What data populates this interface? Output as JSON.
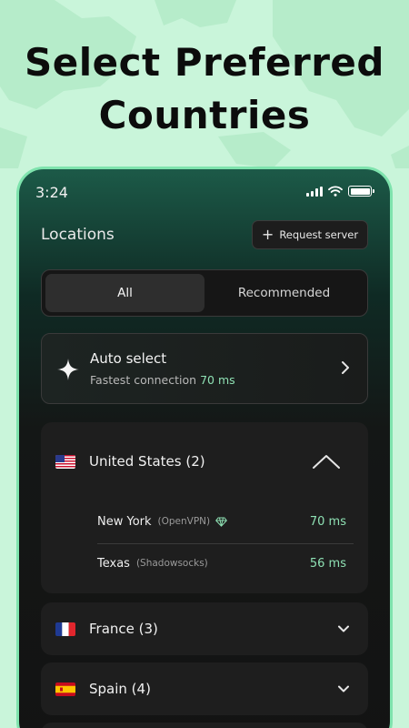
{
  "headline": {
    "line1": "Select Preferred",
    "line2": "Countries"
  },
  "status_bar": {
    "time": "3:24"
  },
  "header": {
    "title": "Locations",
    "request_label": "Request server"
  },
  "tabs": [
    {
      "label": "All",
      "active": true
    },
    {
      "label": "Recommended",
      "active": false
    }
  ],
  "auto_select": {
    "title": "Auto select",
    "subtitle": "Fastest connection",
    "ping": "70 ms"
  },
  "countries": [
    {
      "name": "United States (2)",
      "flag": "us-flag-icon",
      "expanded": true,
      "servers": [
        {
          "city": "New York",
          "protocol": "(OpenVPN)",
          "premium": true,
          "ping": "70 ms"
        },
        {
          "city": "Texas",
          "protocol": "(Shadowsocks)",
          "premium": false,
          "ping": "56 ms"
        }
      ]
    },
    {
      "name": "France (3)",
      "flag": "france-flag-icon",
      "expanded": false
    },
    {
      "name": "Spain (4)",
      "flag": "spain-flag-icon",
      "expanded": false
    }
  ],
  "colors": {
    "background": "#c9f5da",
    "accent": "#8ee0b3",
    "phone_frame": "#7ee3ad",
    "card": "#1e1e1e"
  }
}
